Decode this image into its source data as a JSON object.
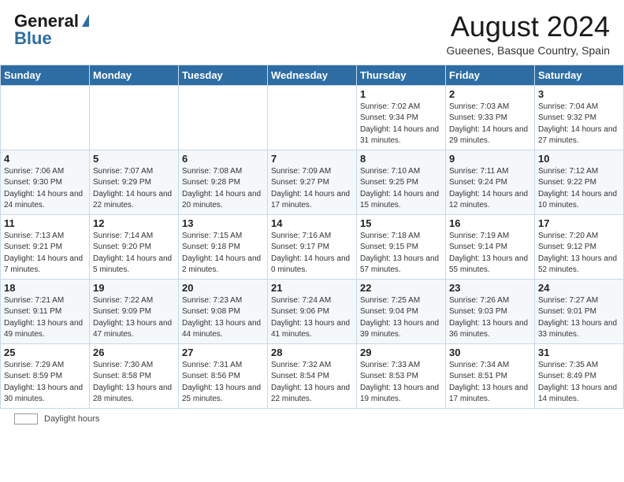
{
  "header": {
    "logo_general": "General",
    "logo_blue": "Blue",
    "month_title": "August 2024",
    "location": "Gueenes, Basque Country, Spain"
  },
  "calendar": {
    "days_of_week": [
      "Sunday",
      "Monday",
      "Tuesday",
      "Wednesday",
      "Thursday",
      "Friday",
      "Saturday"
    ],
    "weeks": [
      [
        {
          "day": "",
          "detail": ""
        },
        {
          "day": "",
          "detail": ""
        },
        {
          "day": "",
          "detail": ""
        },
        {
          "day": "",
          "detail": ""
        },
        {
          "day": "1",
          "detail": "Sunrise: 7:02 AM\nSunset: 9:34 PM\nDaylight: 14 hours and 31 minutes."
        },
        {
          "day": "2",
          "detail": "Sunrise: 7:03 AM\nSunset: 9:33 PM\nDaylight: 14 hours and 29 minutes."
        },
        {
          "day": "3",
          "detail": "Sunrise: 7:04 AM\nSunset: 9:32 PM\nDaylight: 14 hours and 27 minutes."
        }
      ],
      [
        {
          "day": "4",
          "detail": "Sunrise: 7:06 AM\nSunset: 9:30 PM\nDaylight: 14 hours and 24 minutes."
        },
        {
          "day": "5",
          "detail": "Sunrise: 7:07 AM\nSunset: 9:29 PM\nDaylight: 14 hours and 22 minutes."
        },
        {
          "day": "6",
          "detail": "Sunrise: 7:08 AM\nSunset: 9:28 PM\nDaylight: 14 hours and 20 minutes."
        },
        {
          "day": "7",
          "detail": "Sunrise: 7:09 AM\nSunset: 9:27 PM\nDaylight: 14 hours and 17 minutes."
        },
        {
          "day": "8",
          "detail": "Sunrise: 7:10 AM\nSunset: 9:25 PM\nDaylight: 14 hours and 15 minutes."
        },
        {
          "day": "9",
          "detail": "Sunrise: 7:11 AM\nSunset: 9:24 PM\nDaylight: 14 hours and 12 minutes."
        },
        {
          "day": "10",
          "detail": "Sunrise: 7:12 AM\nSunset: 9:22 PM\nDaylight: 14 hours and 10 minutes."
        }
      ],
      [
        {
          "day": "11",
          "detail": "Sunrise: 7:13 AM\nSunset: 9:21 PM\nDaylight: 14 hours and 7 minutes."
        },
        {
          "day": "12",
          "detail": "Sunrise: 7:14 AM\nSunset: 9:20 PM\nDaylight: 14 hours and 5 minutes."
        },
        {
          "day": "13",
          "detail": "Sunrise: 7:15 AM\nSunset: 9:18 PM\nDaylight: 14 hours and 2 minutes."
        },
        {
          "day": "14",
          "detail": "Sunrise: 7:16 AM\nSunset: 9:17 PM\nDaylight: 14 hours and 0 minutes."
        },
        {
          "day": "15",
          "detail": "Sunrise: 7:18 AM\nSunset: 9:15 PM\nDaylight: 13 hours and 57 minutes."
        },
        {
          "day": "16",
          "detail": "Sunrise: 7:19 AM\nSunset: 9:14 PM\nDaylight: 13 hours and 55 minutes."
        },
        {
          "day": "17",
          "detail": "Sunrise: 7:20 AM\nSunset: 9:12 PM\nDaylight: 13 hours and 52 minutes."
        }
      ],
      [
        {
          "day": "18",
          "detail": "Sunrise: 7:21 AM\nSunset: 9:11 PM\nDaylight: 13 hours and 49 minutes."
        },
        {
          "day": "19",
          "detail": "Sunrise: 7:22 AM\nSunset: 9:09 PM\nDaylight: 13 hours and 47 minutes."
        },
        {
          "day": "20",
          "detail": "Sunrise: 7:23 AM\nSunset: 9:08 PM\nDaylight: 13 hours and 44 minutes."
        },
        {
          "day": "21",
          "detail": "Sunrise: 7:24 AM\nSunset: 9:06 PM\nDaylight: 13 hours and 41 minutes."
        },
        {
          "day": "22",
          "detail": "Sunrise: 7:25 AM\nSunset: 9:04 PM\nDaylight: 13 hours and 39 minutes."
        },
        {
          "day": "23",
          "detail": "Sunrise: 7:26 AM\nSunset: 9:03 PM\nDaylight: 13 hours and 36 minutes."
        },
        {
          "day": "24",
          "detail": "Sunrise: 7:27 AM\nSunset: 9:01 PM\nDaylight: 13 hours and 33 minutes."
        }
      ],
      [
        {
          "day": "25",
          "detail": "Sunrise: 7:29 AM\nSunset: 8:59 PM\nDaylight: 13 hours and 30 minutes."
        },
        {
          "day": "26",
          "detail": "Sunrise: 7:30 AM\nSunset: 8:58 PM\nDaylight: 13 hours and 28 minutes."
        },
        {
          "day": "27",
          "detail": "Sunrise: 7:31 AM\nSunset: 8:56 PM\nDaylight: 13 hours and 25 minutes."
        },
        {
          "day": "28",
          "detail": "Sunrise: 7:32 AM\nSunset: 8:54 PM\nDaylight: 13 hours and 22 minutes."
        },
        {
          "day": "29",
          "detail": "Sunrise: 7:33 AM\nSunset: 8:53 PM\nDaylight: 13 hours and 19 minutes."
        },
        {
          "day": "30",
          "detail": "Sunrise: 7:34 AM\nSunset: 8:51 PM\nDaylight: 13 hours and 17 minutes."
        },
        {
          "day": "31",
          "detail": "Sunrise: 7:35 AM\nSunset: 8:49 PM\nDaylight: 13 hours and 14 minutes."
        }
      ]
    ]
  },
  "footer": {
    "daylight_label": "Daylight hours"
  }
}
